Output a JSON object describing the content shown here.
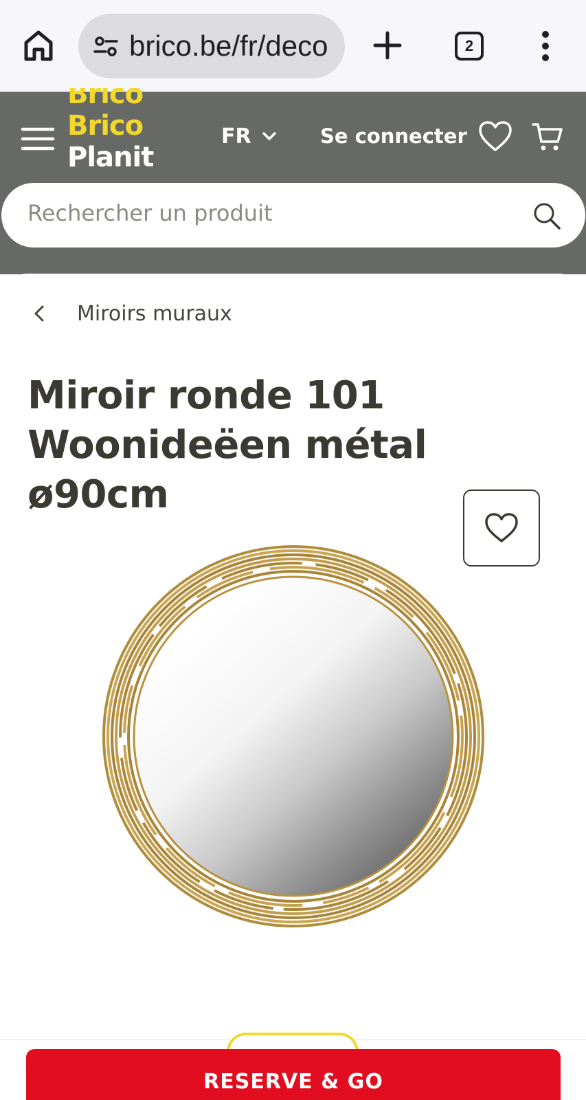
{
  "browser": {
    "url": "brico.be/fr/deco",
    "tab_count": "2",
    "icons": [
      "home-icon",
      "site-info-icon",
      "new-tab-icon",
      "tab-switcher-icon",
      "more-vert-icon"
    ]
  },
  "header": {
    "logo_lines": [
      "Brico",
      "Brico",
      "Planit"
    ],
    "language": "FR",
    "login_label": "Se connecter",
    "icons": [
      "hamburger-menu-icon",
      "chevron-down-icon",
      "heart-icon",
      "cart-icon"
    ],
    "background_color": "#666966",
    "brand_yellow": "#f2d72c",
    "brand_red": "#e0142a"
  },
  "search": {
    "placeholder": "Rechercher un produit",
    "icon": "search-icon"
  },
  "breadcrumb": {
    "label": "Miroirs muraux",
    "icon": "chevron-left-icon"
  },
  "product": {
    "title": "Miroir ronde 101 Woonideëen métal ø90cm",
    "image": "round-gold-metal-mirror",
    "favorite_icon": "heart-outline-icon"
  },
  "cta": {
    "reserve_label": "RESERVE & GO",
    "color": "#e30d20"
  }
}
